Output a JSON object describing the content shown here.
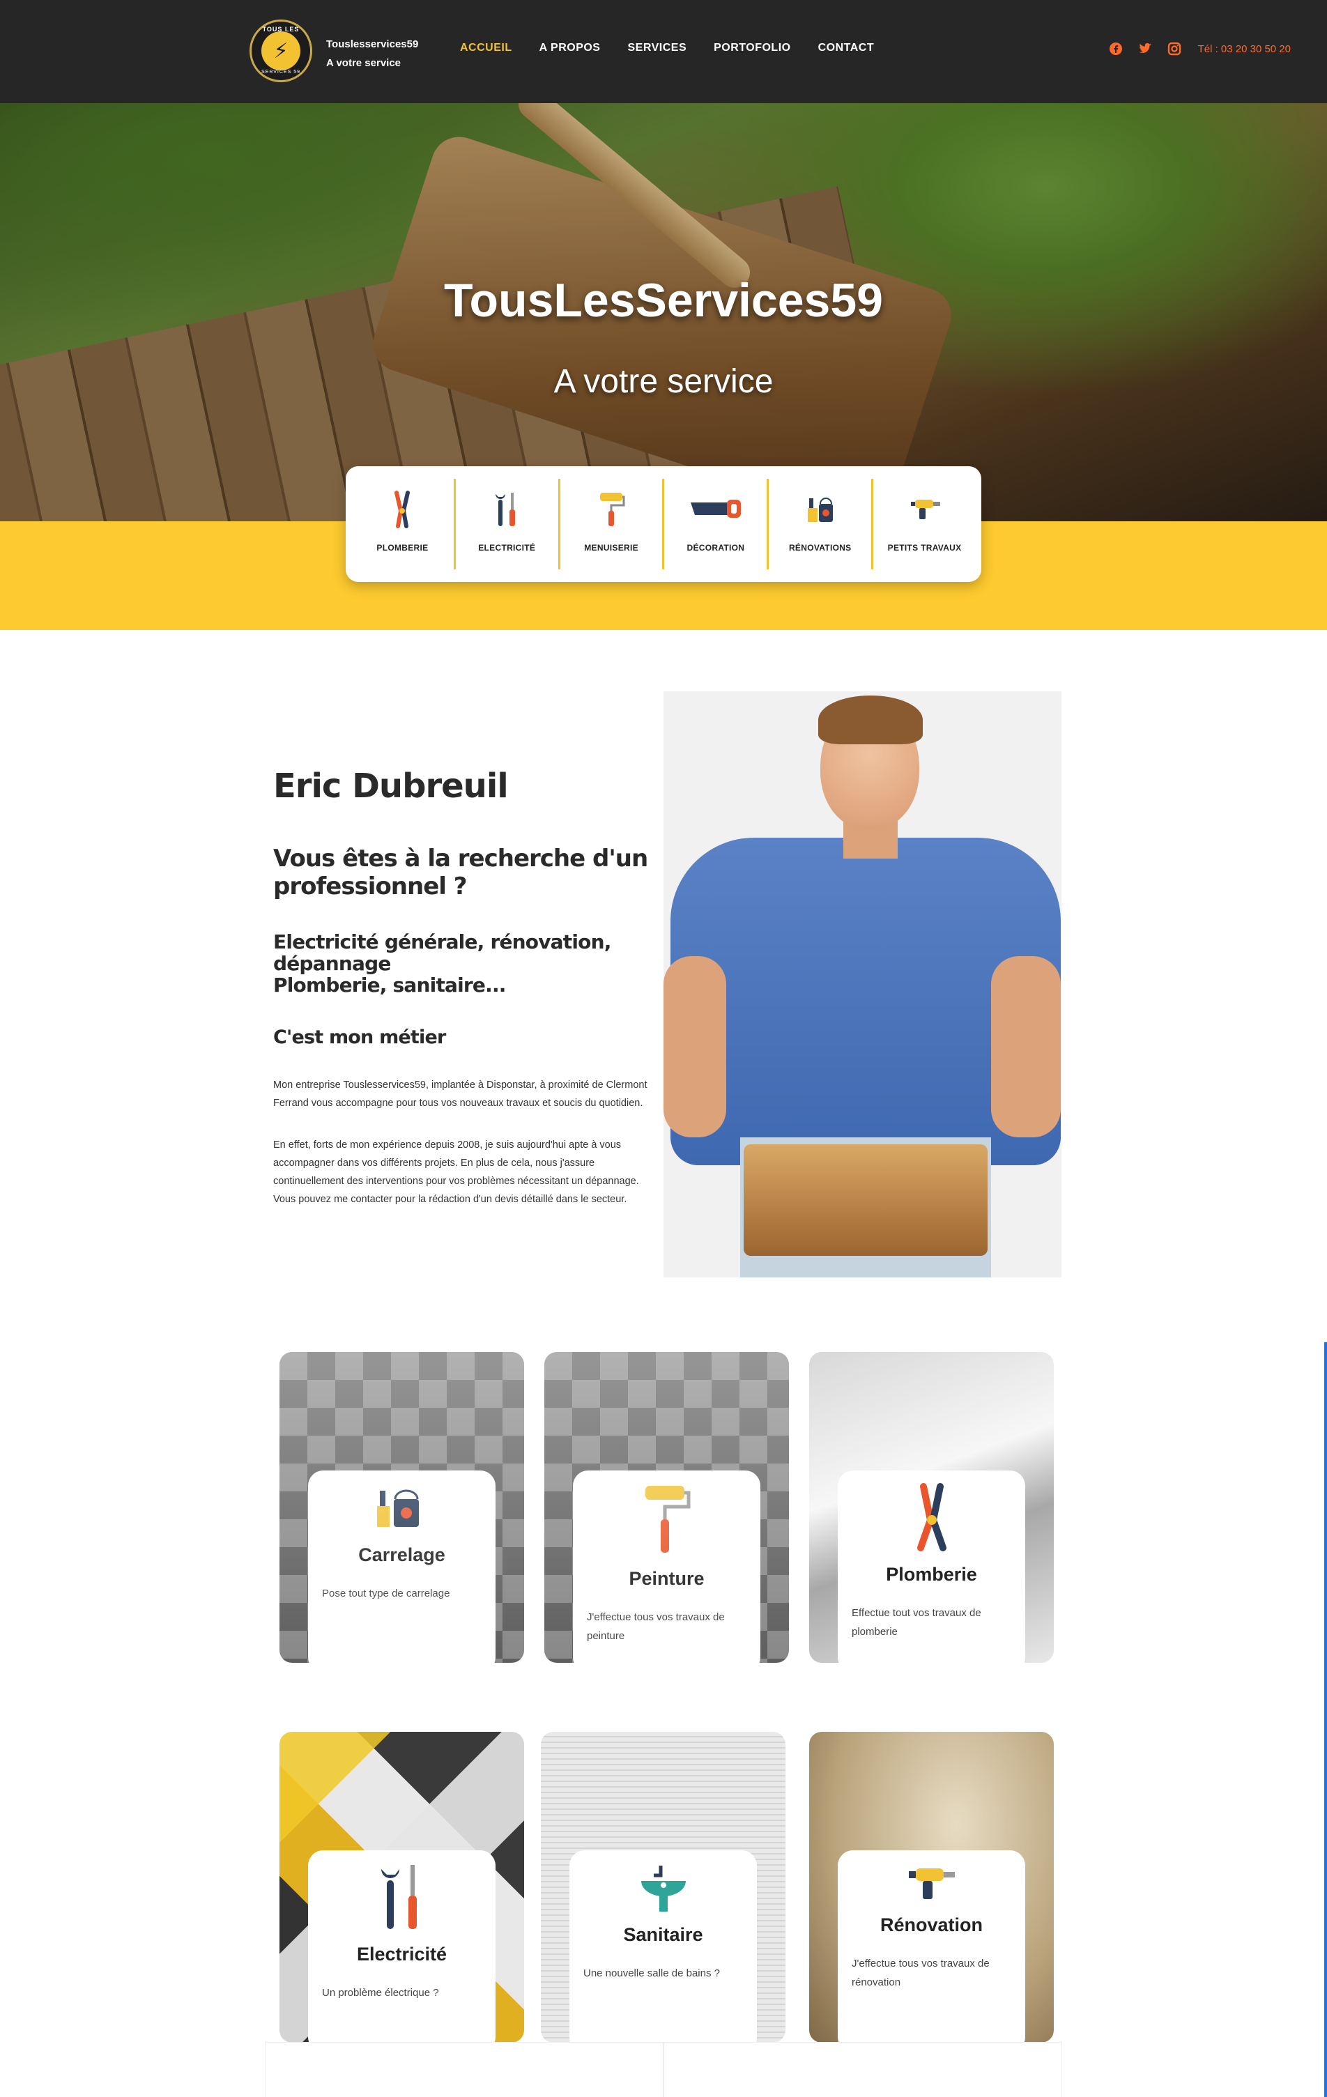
{
  "header": {
    "logo_text_top": "TOUS LES",
    "logo_text_bottom": "SERVICES 59",
    "brand_name": "Touslesservices59",
    "brand_tagline": "A votre service",
    "nav": [
      {
        "label": "ACCUEIL",
        "active": true
      },
      {
        "label": "A PROPOS",
        "active": false
      },
      {
        "label": "SERVICES",
        "active": false
      },
      {
        "label": "PORTOFOLIO",
        "active": false
      },
      {
        "label": "CONTACT",
        "active": false
      }
    ],
    "social_icons": [
      "facebook-icon",
      "twitter-icon",
      "instagram-icon"
    ],
    "phone": "Tél : 03 20 30 50 20"
  },
  "hero": {
    "title": "TousLesServices59",
    "subtitle": "A votre service"
  },
  "service_bar": [
    {
      "label": "PLOMBERIE",
      "icon": "pliers-icon"
    },
    {
      "label": "ELECTRICITÉ",
      "icon": "screwdriver-wrench-icon"
    },
    {
      "label": "MENUISERIE",
      "icon": "paint-roller-icon"
    },
    {
      "label": "DÉCORATION",
      "icon": "saw-icon"
    },
    {
      "label": "RÉNOVATIONS",
      "icon": "paint-bucket-icon"
    },
    {
      "label": "PETITS TRAVAUX",
      "icon": "drill-icon"
    }
  ],
  "about": {
    "name": "Eric Dubreuil",
    "heading": "Vous êtes à la recherche d'un professionnel ?",
    "specialties_line1": "Electricité générale, rénovation, dépannage",
    "specialties_line2": "Plomberie, sanitaire...",
    "tagline": "C'est mon métier",
    "paragraph1": "Mon entreprise Touslesservices59, implantée à Disponstar, à proximité de Clermont Ferrand vous accompagne pour tous vos nouveaux travaux et soucis du quotidien.",
    "paragraph2": "En effet, forts de mon expérience depuis 2008, je suis aujourd'hui apte à vous accompagner dans vos différents projets. En plus de cela, nous j'assure continuellement des interventions pour vos problèmes nécessitant un dépannage. Vous pouvez me contacter pour la rédaction d'un devis détaillé dans le secteur."
  },
  "cards": [
    {
      "title": "Carrelage",
      "desc": "Pose tout type de carrelage",
      "icon": "paint-bucket-icon",
      "bg": "tiles"
    },
    {
      "title": "Peinture",
      "desc": "J'effectue tous vos travaux de peinture",
      "icon": "paint-roller-icon",
      "bg": "tiles"
    },
    {
      "title": "Plomberie",
      "desc": "Effectue tout vos travaux de plomberie",
      "icon": "pliers-icon",
      "bg": "chrome"
    },
    {
      "title": "Electricité",
      "desc": "Un problème électrique ?",
      "icon": "screwdriver-wrench-icon",
      "bg": "elec"
    },
    {
      "title": "Sanitaire",
      "desc": "Une nouvelle salle de bains ?",
      "icon": "sink-icon",
      "bg": "sani"
    },
    {
      "title": "Rénovation",
      "desc": "J'effectue tous vos travaux de rénovation",
      "icon": "drill-icon",
      "bg": "reno"
    }
  ],
  "colors": {
    "accent": "#f2c233",
    "yellow_band": "#fdca2f",
    "topbar": "#262626",
    "social": "#ff6a2b"
  }
}
